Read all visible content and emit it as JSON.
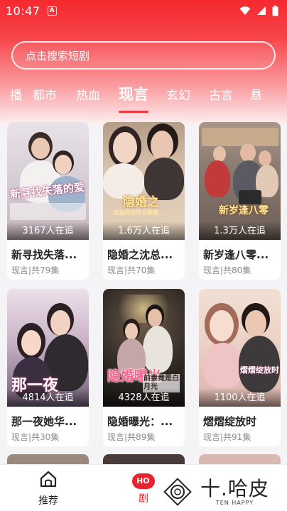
{
  "status_bar": {
    "time": "10:47"
  },
  "search": {
    "placeholder": "点击搜索短剧"
  },
  "tabs": [
    {
      "label": "播"
    },
    {
      "label": "都市"
    },
    {
      "label": "热血"
    },
    {
      "label": "现言"
    },
    {
      "label": "玄幻"
    },
    {
      "label": "古言"
    },
    {
      "label": "悬"
    }
  ],
  "active_tab": "现言",
  "cards": [
    {
      "poster_title": "新寻找失落的爱",
      "views": "3167人在追",
      "title": "新寻找失落...",
      "meta": "现言|共79集"
    },
    {
      "poster_title": "隐婚之",
      "poster_subtitle": "沈总的白月光替身",
      "views": "1.6万人在追",
      "title": "隐婚之沈总...",
      "meta": "现言|共70集"
    },
    {
      "poster_title": "新岁逢八零",
      "views": "1.3万人在追",
      "title": "新岁逢八零...",
      "meta": "现言|共80集"
    },
    {
      "poster_title": "那一夜",
      "views": "4814人在追",
      "title": "那一夜她华...",
      "meta": "现言|共30集"
    },
    {
      "poster_title": "隐婚曝光",
      "poster_subtitle": "前妻竟是白月光",
      "views": "4328人在追",
      "title": "隐婚曝光：...",
      "meta": "现言|共89集"
    },
    {
      "poster_title": "熠熠绽放时",
      "views": "1100人在追",
      "title": "熠熠绽放时",
      "meta": "现言|共91集"
    }
  ],
  "bottom_nav": {
    "home_label": "推荐",
    "drama_label": "剧",
    "drama_badge": "HO"
  },
  "watermark": {
    "main": "十.哈皮",
    "sub": "TEN HAPPY"
  },
  "colors": {
    "accent": "#f0393e",
    "header_top": "#f5292f"
  }
}
